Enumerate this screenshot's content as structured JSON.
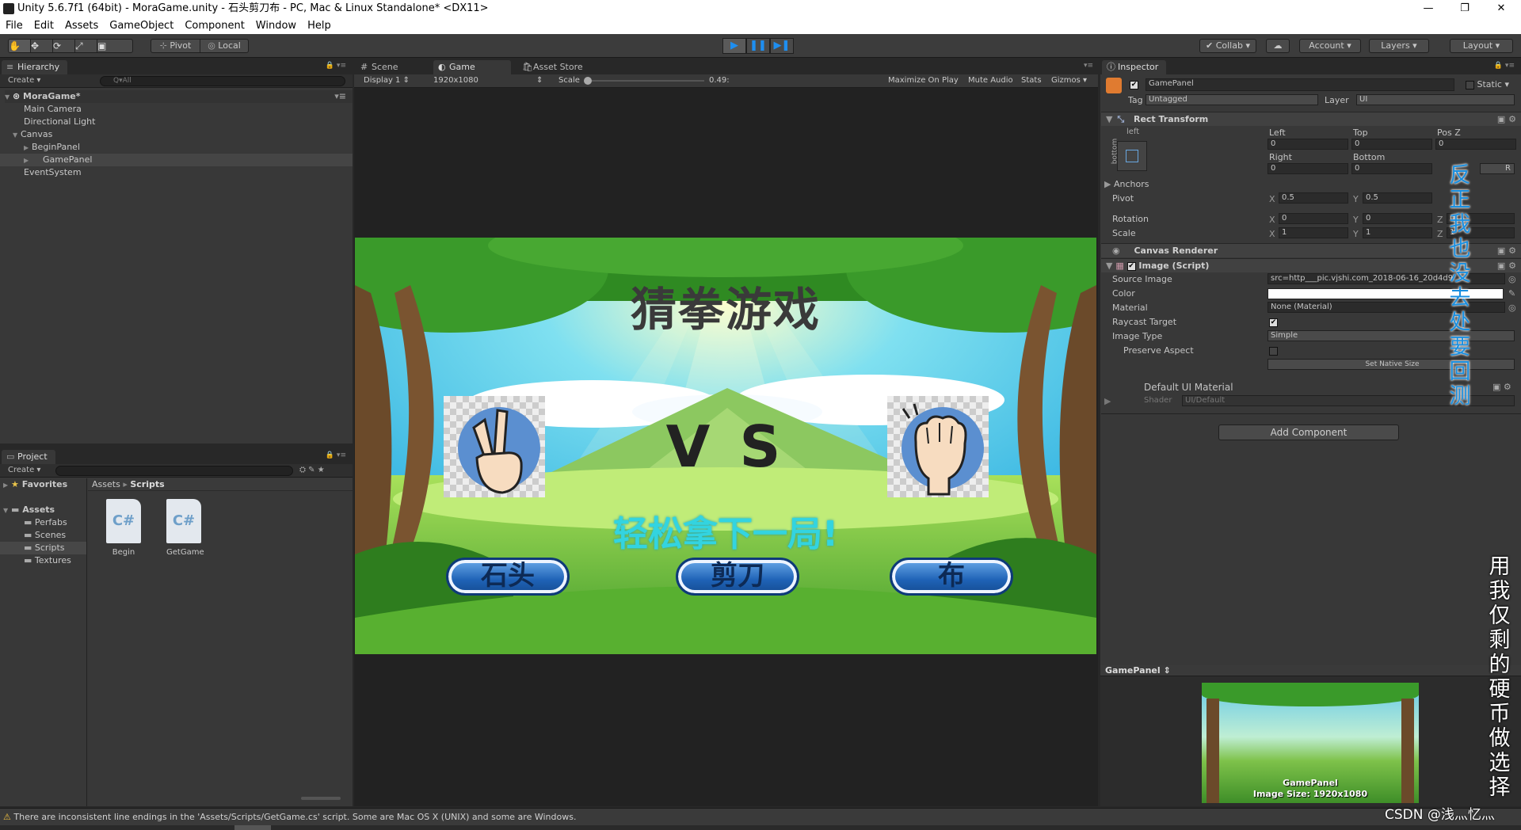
{
  "window": {
    "title": "Unity 5.6.7f1 (64bit) - MoraGame.unity - 石头剪刀布 - PC, Mac & Linux Standalone* <DX11>",
    "minimize": "—",
    "maximize": "❐",
    "close": "✕"
  },
  "menu": [
    "File",
    "Edit",
    "Assets",
    "GameObject",
    "Component",
    "Window",
    "Help"
  ],
  "toolbar": {
    "pivot": "Pivot",
    "local": "Local",
    "collab": "Collab ▾",
    "account": "Account ▾",
    "layers": "Layers ▾",
    "layout": "Layout ▾"
  },
  "hierarchy": {
    "tab": "Hierarchy",
    "create": "Create ▾",
    "search": "Q▾All",
    "scene": "MoraGame*",
    "items": [
      "Main Camera",
      "Directional Light",
      "Canvas",
      "BeginPanel",
      "GamePanel",
      "EventSystem"
    ]
  },
  "project": {
    "tab": "Project",
    "create": "Create ▾",
    "favorites": "Favorites",
    "assets": "Assets",
    "folders": [
      "Perfabs",
      "Scenes",
      "Scripts",
      "Textures"
    ],
    "breadcrumb_root": "Assets",
    "breadcrumb_sep": "▸",
    "breadcrumb_current": "Scripts",
    "files": [
      "Begin",
      "GetGame"
    ],
    "file_glyph": "C#"
  },
  "viewtabs": [
    "Scene",
    "Game",
    "Asset Store"
  ],
  "gamebar": {
    "display": "Display 1",
    "resolution": "1920x1080",
    "scale_label": "Scale",
    "scale_value": "0.49:",
    "maximize": "Maximize On Play",
    "mute": "Mute Audio",
    "stats": "Stats",
    "gizmos": "Gizmos ▾"
  },
  "game": {
    "title": "猜拳游戏",
    "vs": "V S",
    "result": "轻松拿下一局!",
    "buttons": [
      "石头",
      "剪刀",
      "布"
    ]
  },
  "inspector": {
    "tab": "Inspector",
    "object_name": "GamePanel",
    "static": "Static ▾",
    "tag_label": "Tag",
    "tag_value": "Untagged",
    "layer_label": "Layer",
    "layer_value": "UI",
    "rect_transform": {
      "header": "Rect Transform",
      "anchor_h": "left",
      "anchor_v": "bottom",
      "left_label": "Left",
      "top_label": "Top",
      "posz_label": "Pos Z",
      "left": "0",
      "top": "0",
      "posz": "0",
      "right_label": "Right",
      "bottom_label": "Bottom",
      "right": "0",
      "bottom": "0",
      "r_button": "R",
      "anchors": "Anchors",
      "pivot_label": "Pivot",
      "pivot_x": "0.5",
      "pivot_y": "0.5",
      "rotation_label": "Rotation",
      "rot_x": "0",
      "rot_y": "0",
      "rot_z": "0",
      "scale_label": "Scale",
      "scale_x": "1",
      "scale_y": "1",
      "scale_z": "1"
    },
    "canvas_renderer": "Canvas Renderer",
    "image_script": {
      "header": "Image (Script)",
      "source_image_label": "Source Image",
      "source_image": "src=http___pic.vjshi.com_2018-06-16_20d4d9",
      "color_label": "Color",
      "material_label": "Material",
      "material": "None (Material)",
      "raycast_label": "Raycast Target",
      "image_type_label": "Image Type",
      "image_type": "Simple",
      "preserve_label": "Preserve Aspect",
      "native_size": "Set Native Size"
    },
    "default_material": "Default UI Material",
    "shader_label": "Shader",
    "shader_value": "UI/Default",
    "add_component": "Add Component",
    "preview_title": "GamePanel ⇕",
    "preview_name": "GamePanel",
    "preview_size": "Image Size: 1920x1080"
  },
  "overlay": {
    "blue_text": [
      "反",
      "正",
      "我",
      "也",
      "没",
      "去",
      "处",
      "要",
      "回",
      "测"
    ],
    "white_text": [
      "用",
      "我",
      "仅",
      "剩",
      "的",
      "硬",
      "币",
      "做",
      "选",
      "择"
    ],
    "watermark": "CSDN @浅灬忆灬"
  },
  "status": {
    "warning": "There are inconsistent line endings in the 'Assets/Scripts/GetGame.cs' script. Some are Mac OS X (UNIX) and some are Windows."
  },
  "colors": {
    "accent": "#1e8ef0",
    "blue_overlay": "#1a8fe0",
    "result_text": "#33d4e0",
    "warning": "#f0c040"
  }
}
